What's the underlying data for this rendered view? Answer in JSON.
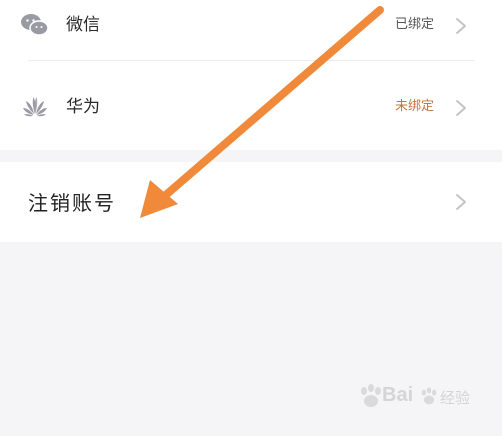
{
  "accounts": {
    "wechat": {
      "label": "微信",
      "status": "已绑定",
      "icon": "wechat-icon"
    },
    "huawei": {
      "label": "华为",
      "status": "未绑定",
      "icon": "huawei-icon"
    }
  },
  "cancel_account": {
    "label": "注销账号"
  },
  "colors": {
    "background": "#f5f5f7",
    "card": "#ffffff",
    "unbound_status": "#c8743c",
    "arrow": "#f0893a",
    "icon_gray": "#9a9aa2"
  },
  "watermark": {
    "brand": "Bai",
    "suffix": "经验"
  }
}
